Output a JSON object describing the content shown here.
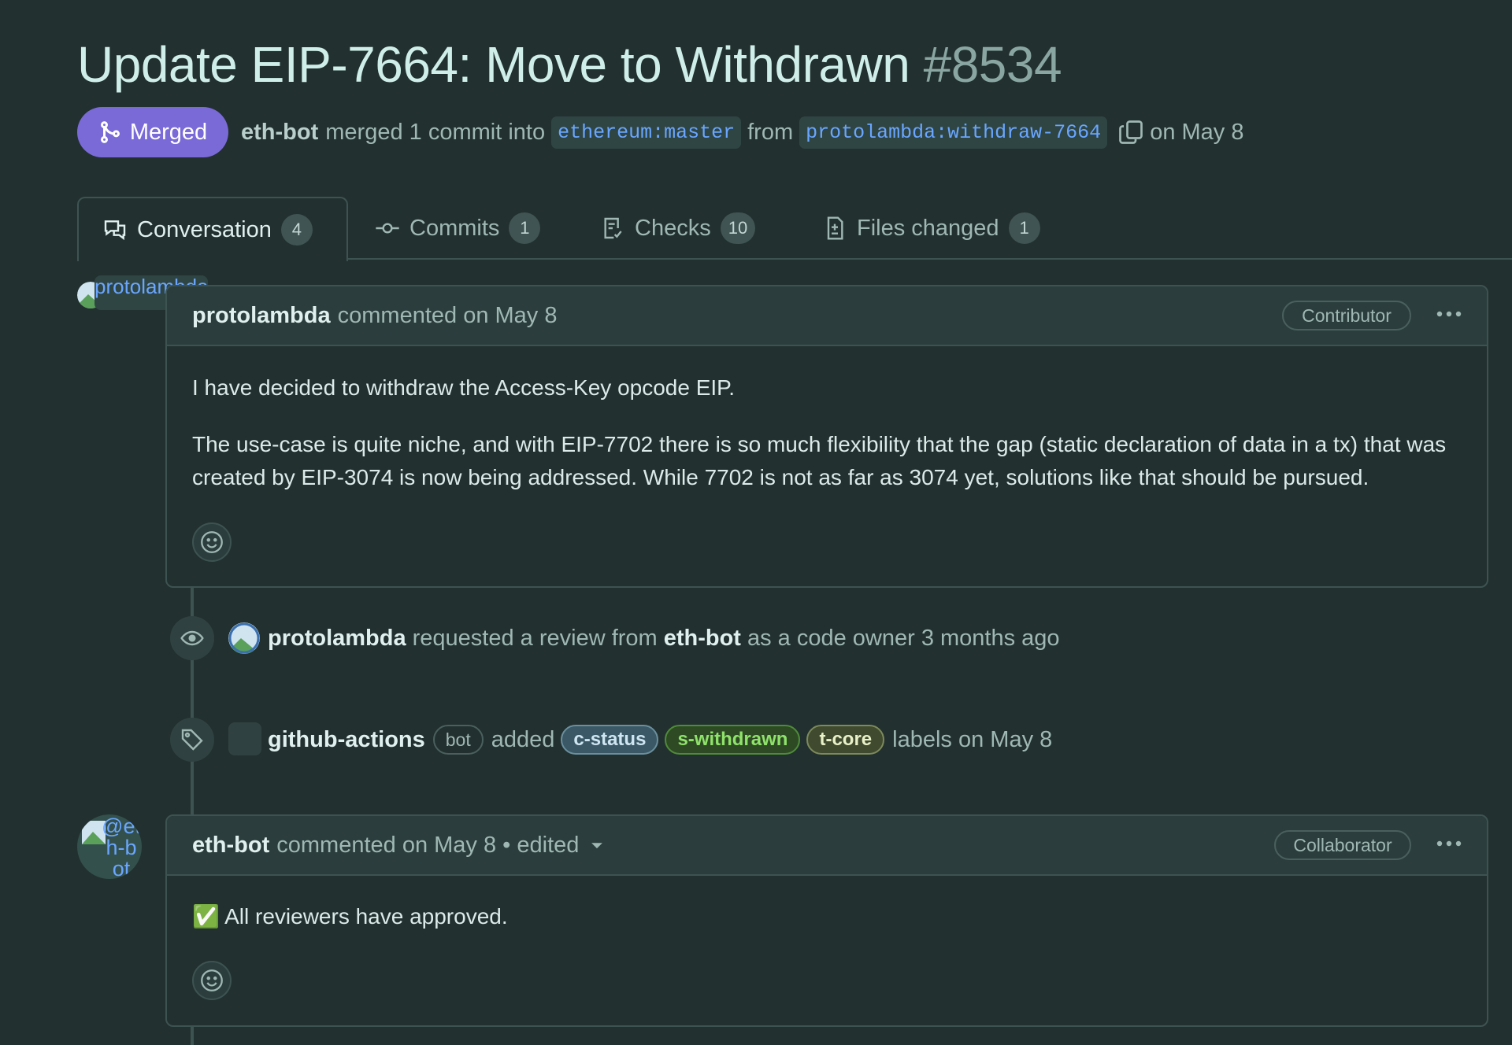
{
  "pr": {
    "title": "Update EIP-7664: Move to Withdrawn",
    "number": "#8534",
    "state": "Merged",
    "merger": "eth-bot",
    "merged_text": "merged 1 commit into",
    "base_branch": "ethereum:master",
    "from_text": "from",
    "head_branch": "protolambda:withdraw-7664",
    "date": "on May 8"
  },
  "tabs": [
    {
      "label": "Conversation",
      "count": "4",
      "active": true
    },
    {
      "label": "Commits",
      "count": "1"
    },
    {
      "label": "Checks",
      "count": "10"
    },
    {
      "label": "Files changed",
      "count": "1"
    }
  ],
  "comment1": {
    "avatar_alt": "protolambda",
    "author": "protolambda",
    "meta": "commented on May 8",
    "role": "Contributor",
    "paragraphs": [
      "I have decided to withdraw the Access-Key opcode EIP.",
      "The use-case is quite niche, and with EIP-7702 there is so much flexibility that the gap (static declaration of data in a tx) that was created by EIP-3074 is now being addressed. While 7702 is not as far as 3074 yet, solutions like that should be pursued."
    ]
  },
  "event_review": {
    "actor": "protolambda",
    "text1": "requested a review from",
    "reviewer": "eth-bot",
    "text2": "as a code owner 3 months ago"
  },
  "event_labels": {
    "actor": "github-actions",
    "bot_tag": "bot",
    "text1": "added",
    "labels": [
      {
        "name": "c-status",
        "bg": "#3a5866",
        "fg": "#cfe6f2",
        "border": "#6b8f9e"
      },
      {
        "name": "s-withdrawn",
        "bg": "#2e4a25",
        "fg": "#8fe26a",
        "border": "#4f8b3a"
      },
      {
        "name": "t-core",
        "bg": "#3f4a2e",
        "fg": "#e8f0c8",
        "border": "#7d8a5c"
      }
    ],
    "text2": "labels on May 8"
  },
  "comment2": {
    "avatar_alt": "@eth-bot",
    "author": "eth-bot",
    "meta": "commented on May 8 • edited",
    "role": "Collaborator",
    "body_emoji": "✅",
    "body": "All reviewers have approved."
  },
  "colors": {
    "background": "#22302f",
    "merged": "#7a6ad8",
    "link": "#6aa6ff"
  }
}
